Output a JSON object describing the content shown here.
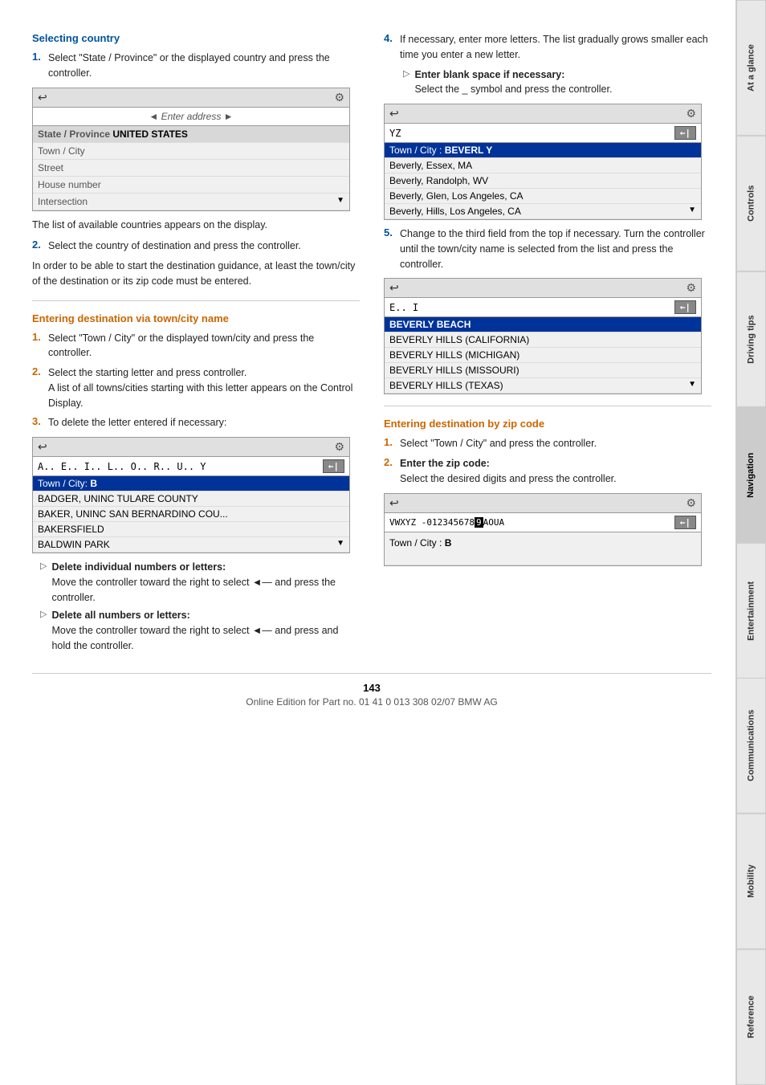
{
  "page": {
    "number": "143",
    "footer_text": "Online Edition for Part no. 01 41 0 013 308 02/07 BMW AG"
  },
  "sidebar": {
    "tabs": [
      {
        "label": "At a glance",
        "active": false
      },
      {
        "label": "Controls",
        "active": false
      },
      {
        "label": "Driving tips",
        "active": false
      },
      {
        "label": "Navigation",
        "active": true
      },
      {
        "label": "Entertainment",
        "active": false
      },
      {
        "label": "Communications",
        "active": false
      },
      {
        "label": "Mobility",
        "active": false
      },
      {
        "label": "Reference",
        "active": false
      }
    ]
  },
  "selecting_country": {
    "heading": "Selecting country",
    "step1": "Select \"State / Province\" or the displayed country and press the controller.",
    "step2_label": "2.",
    "step2": "Select the country of destination and press the controller.",
    "para1": "The list of available countries appears on the display.",
    "para2": "In order to be able to start the destination guidance, at least the town/city of the destination or its zip code must be entered.",
    "nav_box1": {
      "back_icon": "↩",
      "settings_icon": "⚙",
      "input_text": "◄ Enter address ►",
      "rows": [
        {
          "label": "State / Province",
          "value": "UNITED STATES",
          "highlighted": true
        },
        {
          "label": "Town / City",
          "value": ""
        },
        {
          "label": "Street",
          "value": ""
        },
        {
          "label": "House number",
          "value": ""
        },
        {
          "label": "Intersection",
          "value": ""
        }
      ]
    }
  },
  "entering_town": {
    "heading": "Entering destination via town/city name",
    "step1": "Select \"Town / City\" or the displayed town/city and press the controller.",
    "step2": "Select the starting letter and press controller.",
    "step2_note": "A list of all towns/cities starting with this letter appears on the Control Display.",
    "step3": "To delete the letter entered if necessary:",
    "nav_box2": {
      "back_icon": "↩",
      "settings_icon": "⚙",
      "keyboard_row": "A.. E.. I.. L.. O.. R.. U.. Y",
      "enter_key": "←|",
      "rows": [
        {
          "text": "Town / City:",
          "value": "B",
          "highlighted": true
        },
        {
          "text": "BADGER, UNINC TULARE COUNTY"
        },
        {
          "text": "BAKER, UNINC SAN BERNARDINO COU..."
        },
        {
          "text": "BAKERSFIELD"
        },
        {
          "text": "BALDWIN PARK"
        }
      ]
    },
    "bullet1_title": "Delete individual numbers or letters:",
    "bullet1_text": "Move the controller toward the right to select ◄— and press the controller.",
    "bullet2_title": "Delete all numbers or letters:",
    "bullet2_text": "Move the controller toward the right to select ◄— and press and hold the controller."
  },
  "step4_section": {
    "step4": "If necessary, enter more letters. The list gradually grows smaller each time you enter a new letter.",
    "bullet_note_title": "Enter blank space if necessary:",
    "bullet_note_text": "Select the _ symbol and press the controller.",
    "nav_box3": {
      "back_icon": "↩",
      "settings_icon": "⚙",
      "keyboard_row": "YZ",
      "enter_key": "←|",
      "town_city_label": "Town / City :",
      "town_city_value": "BEVERL Y",
      "rows": [
        {
          "text": "Beverly, Essex, MA"
        },
        {
          "text": "Beverly, Randolph, WV"
        },
        {
          "text": "Beverly, Glen, Los Angeles, CA"
        },
        {
          "text": "Beverly, Hills, Los Angeles, CA"
        }
      ]
    },
    "step5": "Change to the third field from the top if necessary. Turn the controller until the town/city name is selected from the list and press the controller.",
    "nav_box4": {
      "back_icon": "↩",
      "settings_icon": "⚙",
      "keyboard_row": "E.. I",
      "enter_key": "←|",
      "rows": [
        {
          "text": "BEVERLY BEACH",
          "highlighted": true
        },
        {
          "text": "BEVERLY HILLS (CALIFORNIA)"
        },
        {
          "text": "BEVERLY HILLS (MICHIGAN)"
        },
        {
          "text": "BEVERLY HILLS (MISSOURI)"
        },
        {
          "text": "BEVERLY HILLS (TEXAS)"
        }
      ]
    }
  },
  "entering_zip": {
    "heading": "Entering destination by zip code",
    "step1": "Select \"Town / City\" and press the controller.",
    "step2_title": "Enter the zip code:",
    "step2_text": "Select the desired digits and press the controller.",
    "nav_box5": {
      "back_icon": "↩",
      "settings_icon": "⚙",
      "keyboard_row": "VWXYZ -0123456789AOUA",
      "enter_key": "←|",
      "town_city_label": "Town / City :",
      "town_city_value": "B"
    }
  }
}
